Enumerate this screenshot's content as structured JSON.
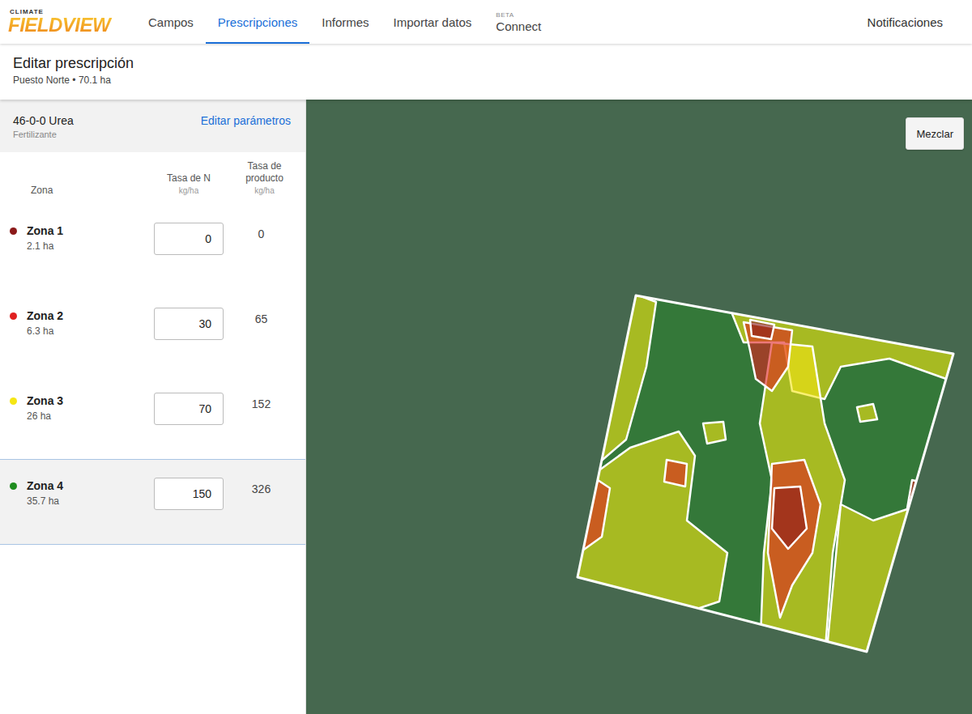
{
  "logo": {
    "top": "CLIMATE",
    "main": "FIELDVIEW"
  },
  "nav": [
    {
      "label": "Campos",
      "selected": false
    },
    {
      "label": "Prescripciones",
      "selected": true
    },
    {
      "label": "Informes",
      "selected": false
    },
    {
      "label": "Importar datos",
      "selected": false
    },
    {
      "label": "Connect",
      "badge": "BETA",
      "selected": false
    }
  ],
  "notifications": "Notificaciones",
  "page": {
    "title": "Editar prescripción",
    "subtitle": "Puesto Norte • 70.1 ha"
  },
  "product": {
    "name": "46-0-0 Urea",
    "type": "Fertilizante",
    "edit_link": "Editar parámetros"
  },
  "columns": {
    "zone": "Zona",
    "n_rate": "Tasa de N",
    "n_unit": "kg/ha",
    "product_rate": "Tasa de producto",
    "product_unit": "kg/ha"
  },
  "zones": [
    {
      "name": "Zona 1",
      "area": "2.1 ha",
      "n_rate": "0",
      "product_rate": "0",
      "color": "#8b1a1a",
      "selected": false
    },
    {
      "name": "Zona 2",
      "area": "6.3 ha",
      "n_rate": "30",
      "product_rate": "65",
      "color": "#e02020",
      "selected": false
    },
    {
      "name": "Zona 3",
      "area": "26 ha",
      "n_rate": "70",
      "product_rate": "152",
      "color": "#f5e614",
      "selected": false
    },
    {
      "name": "Zona 4",
      "area": "35.7 ha",
      "n_rate": "150",
      "product_rate": "326",
      "color": "#1e8c1e",
      "selected": true
    }
  ],
  "map": {
    "button": "Mezclar"
  }
}
